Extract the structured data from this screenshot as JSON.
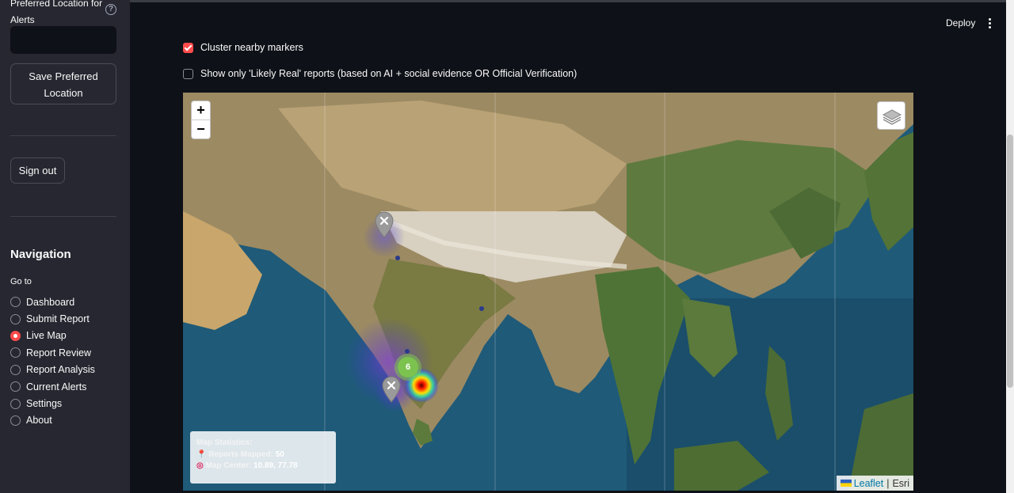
{
  "sidebar": {
    "pref_label": "Preferred Location for Alerts",
    "pref_input_value": "",
    "pref_input_placeholder": "",
    "save_button": "Save Preferred Location",
    "signout_button": "Sign out",
    "nav_title": "Navigation",
    "goto_label": "Go to",
    "nav_items": [
      {
        "label": "Dashboard",
        "selected": false
      },
      {
        "label": "Submit Report",
        "selected": false
      },
      {
        "label": "Live Map",
        "selected": true
      },
      {
        "label": "Report Review",
        "selected": false
      },
      {
        "label": "Report Analysis",
        "selected": false
      },
      {
        "label": "Current Alerts",
        "selected": false
      },
      {
        "label": "Settings",
        "selected": false
      },
      {
        "label": "About",
        "selected": false
      }
    ]
  },
  "header": {
    "deploy_label": "Deploy"
  },
  "main": {
    "cluster_checkbox": {
      "label": "Cluster nearby markers",
      "checked": true
    },
    "likely_real_checkbox": {
      "label": "Show only 'Likely Real' reports (based on AI + social evidence OR Official Verification)",
      "checked": false
    }
  },
  "map": {
    "zoom_in": "+",
    "zoom_out": "−",
    "cluster_count": "6",
    "stats": {
      "title": "Map Statistics:",
      "reports_label": "Reports Mapped:",
      "reports_value": "50",
      "center_label": "Map Center:",
      "center_value": "10.89, 77.78"
    },
    "attribution": {
      "leaflet": "Leaflet",
      "separator": "|",
      "provider": "Esri"
    }
  },
  "colors": {
    "accent": "#ff4b4b",
    "sidebar_bg": "#262730",
    "main_bg": "#0e1117",
    "cluster": "#7cc24f"
  }
}
